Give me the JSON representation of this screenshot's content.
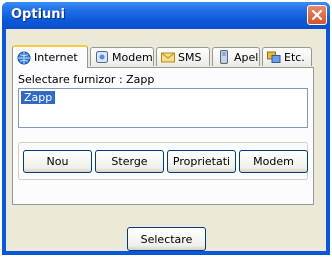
{
  "window": {
    "title": "Optiuni"
  },
  "tabs": [
    {
      "label": "Internet",
      "icon": "globe-icon"
    },
    {
      "label": "Modem",
      "icon": "modem-icon"
    },
    {
      "label": "SMS",
      "icon": "envelope-icon"
    },
    {
      "label": "Apel",
      "icon": "phone-icon"
    },
    {
      "label": "Etc.",
      "icon": "folders-icon"
    }
  ],
  "internet": {
    "provider_label": "Selectare furnizor : Zapp",
    "providers": [
      "Zapp"
    ],
    "buttons": {
      "new": "Nou",
      "delete": "Sterge",
      "properties": "Proprietati",
      "modem": "Modem"
    }
  },
  "footer": {
    "select": "Selectare"
  },
  "colors": {
    "titlebar": "#0b58d8",
    "selection": "#316ac5",
    "active_tab_accent": "#ffc83c"
  }
}
